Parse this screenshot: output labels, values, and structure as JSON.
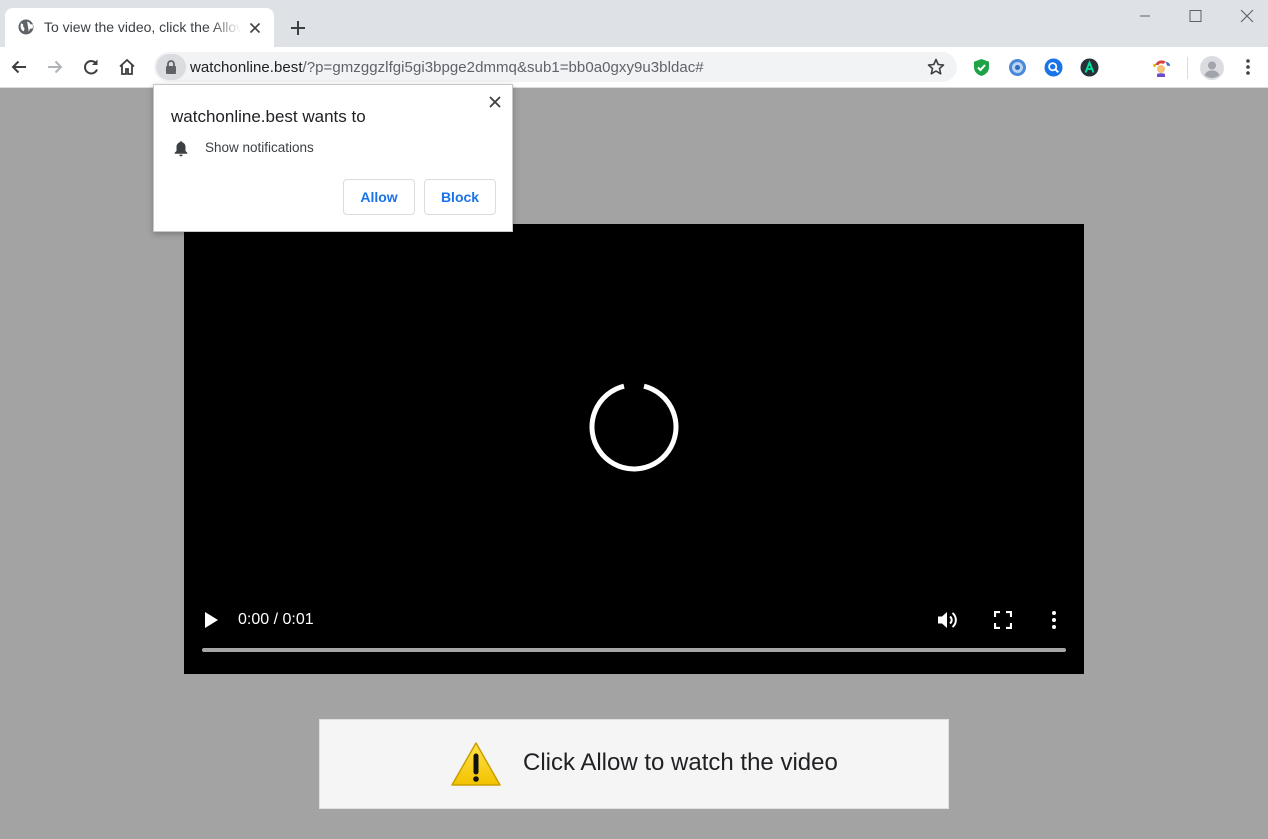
{
  "browser": {
    "tab": {
      "title": "To view the video, click the Allow button"
    },
    "address": {
      "host": "watchonline.best",
      "path": "/?p=gmzggzlfgi5gi3bpge2dmmq&sub1=bb0a0gxy9u3bldac#"
    }
  },
  "prompt": {
    "title": "watchonline.best wants to",
    "permission": "Show notifications",
    "allow_label": "Allow",
    "block_label": "Block"
  },
  "video": {
    "time": "0:00 / 0:01"
  },
  "banner": {
    "text": "Click Allow to watch the video"
  },
  "colors": {
    "page_background": "#a3a3a3",
    "accent": "#1a73e8",
    "warning": "#f9d511"
  }
}
